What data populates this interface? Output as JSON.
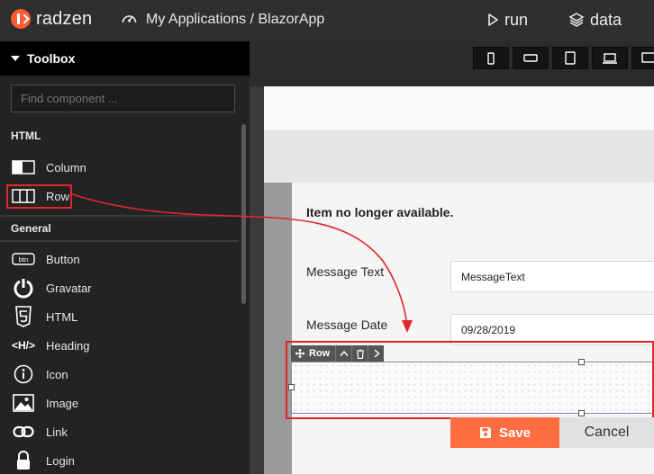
{
  "header": {
    "brand": "radzen",
    "breadcrumb": "My Applications / BlazorApp",
    "run_label": "run",
    "data_label": "data"
  },
  "toolbox": {
    "title": "Toolbox",
    "search_placeholder": "Find component ...",
    "sections": [
      {
        "title": "HTML",
        "items": [
          {
            "label": "Column",
            "icon": "column-icon"
          },
          {
            "label": "Row",
            "icon": "row-icon"
          }
        ]
      },
      {
        "title": "General",
        "items": [
          {
            "label": "Button",
            "icon": "btn-icon"
          },
          {
            "label": "Gravatar",
            "icon": "gravatar-icon"
          },
          {
            "label": "HTML",
            "icon": "html5-icon"
          },
          {
            "label": "Heading",
            "icon": "heading-icon"
          },
          {
            "label": "Icon",
            "icon": "info-icon"
          },
          {
            "label": "Image",
            "icon": "image-icon"
          },
          {
            "label": "Link",
            "icon": "link-icon"
          },
          {
            "label": "Login",
            "icon": "login-icon"
          }
        ]
      }
    ],
    "btn_glyph": "btn",
    "heading_glyph": "<H/>"
  },
  "devices": [
    "phone-portrait",
    "phone-landscape",
    "tablet",
    "laptop",
    "desktop"
  ],
  "page": {
    "alert": "Item no longer available.",
    "fields": [
      {
        "label": "Message Text",
        "value": "MessageText"
      },
      {
        "label": "Message Date",
        "value": "09/28/2019"
      }
    ],
    "row_tag": "Row",
    "save_label": "Save",
    "cancel_label": "Cancel"
  },
  "colors": {
    "accent": "#ff6d40",
    "selection": "#e1262a",
    "toolbox_bg": "#232323"
  }
}
